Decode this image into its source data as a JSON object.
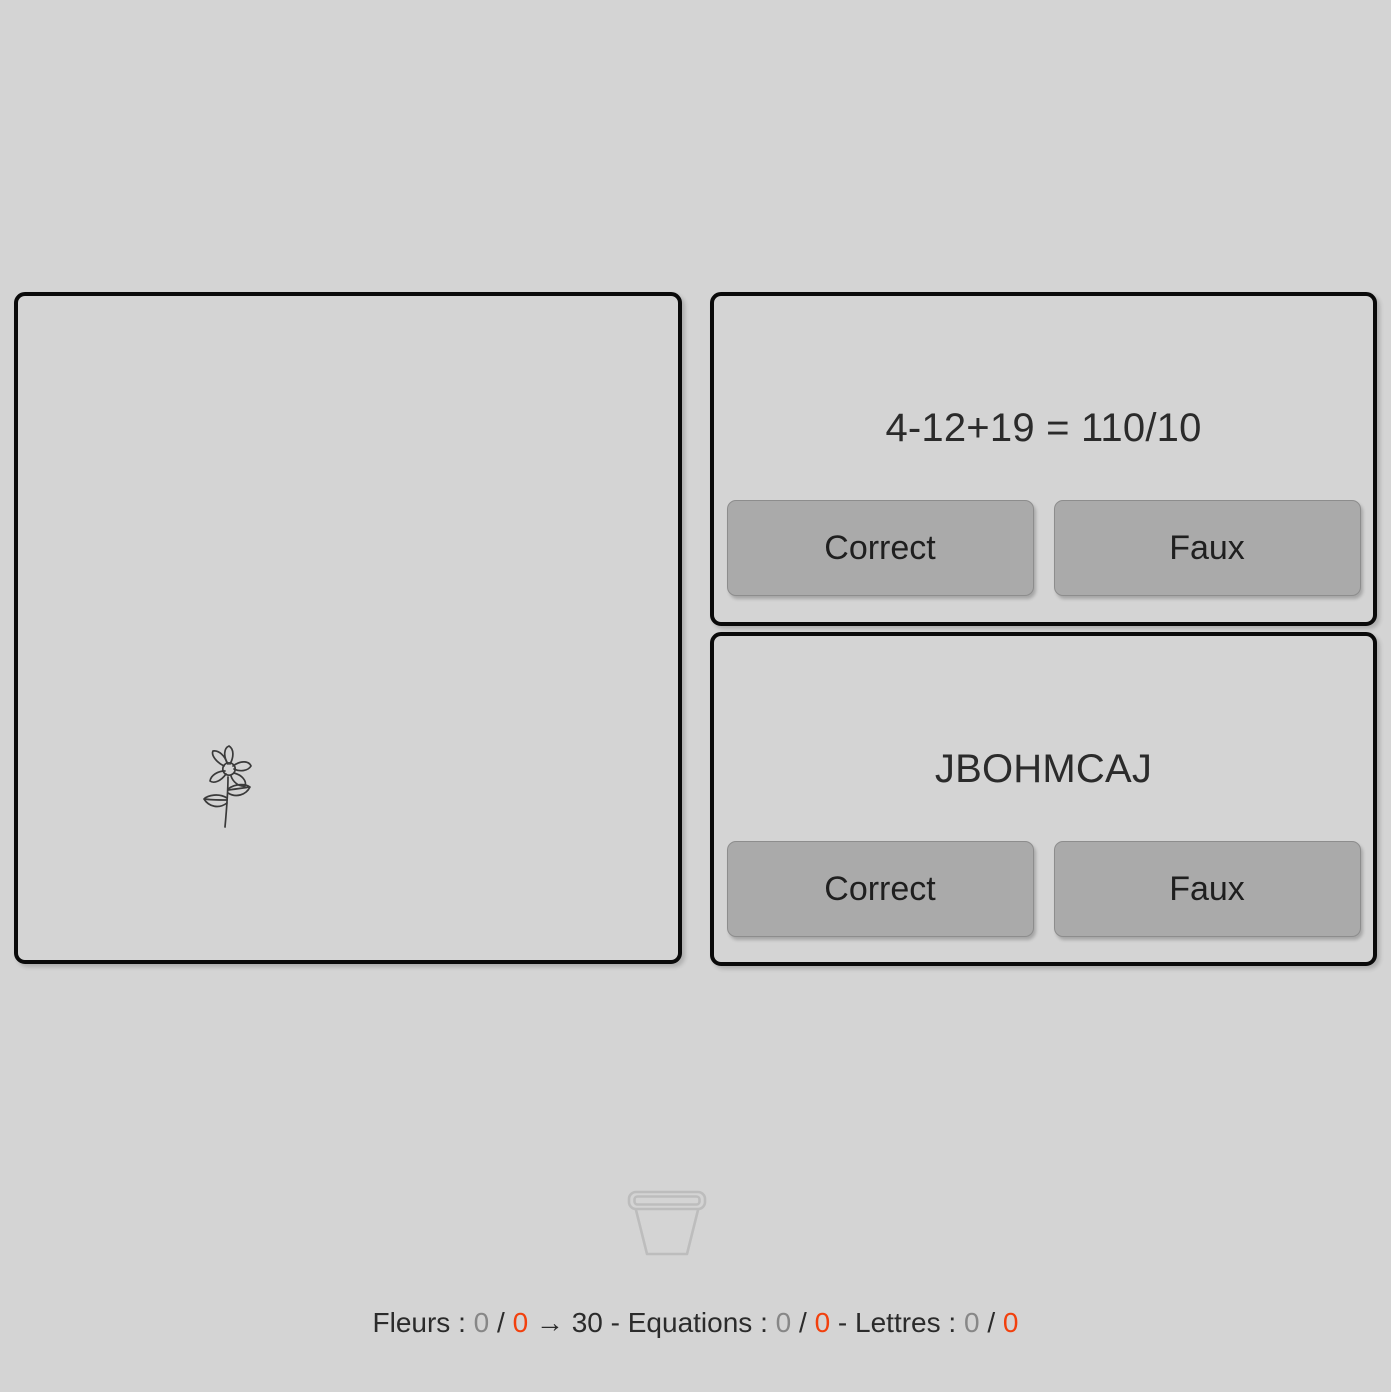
{
  "garden": {
    "flower_icon": "flower-icon",
    "pot_icon": "flower-pot-icon"
  },
  "equation_panel": {
    "question": "4-12+19 = 110/10",
    "correct_label": "Correct",
    "false_label": "Faux"
  },
  "letters_panel": {
    "question": "JBOHMCAJ",
    "correct_label": "Correct",
    "false_label": "Faux"
  },
  "status": {
    "fleurs_label": "Fleurs :",
    "fleurs_current": "0",
    "fleurs_slash": "/",
    "fleurs_errors": "0",
    "fleurs_arrow": "→",
    "fleurs_goal": "30",
    "sep1": "-",
    "equations_label": "Equations :",
    "equations_current": "0",
    "equations_slash": "/",
    "equations_errors": "0",
    "sep2": "-",
    "lettres_label": "Lettres :",
    "lettres_current": "0",
    "lettres_slash": "/",
    "lettres_errors": "0"
  },
  "colors": {
    "background": "#d4d4d4",
    "panel_border": "#0a0a0a",
    "button_fill": "#aaaaaa",
    "text": "#2b2b2b",
    "value_neutral": "#878787",
    "value_error": "#f2400d"
  }
}
